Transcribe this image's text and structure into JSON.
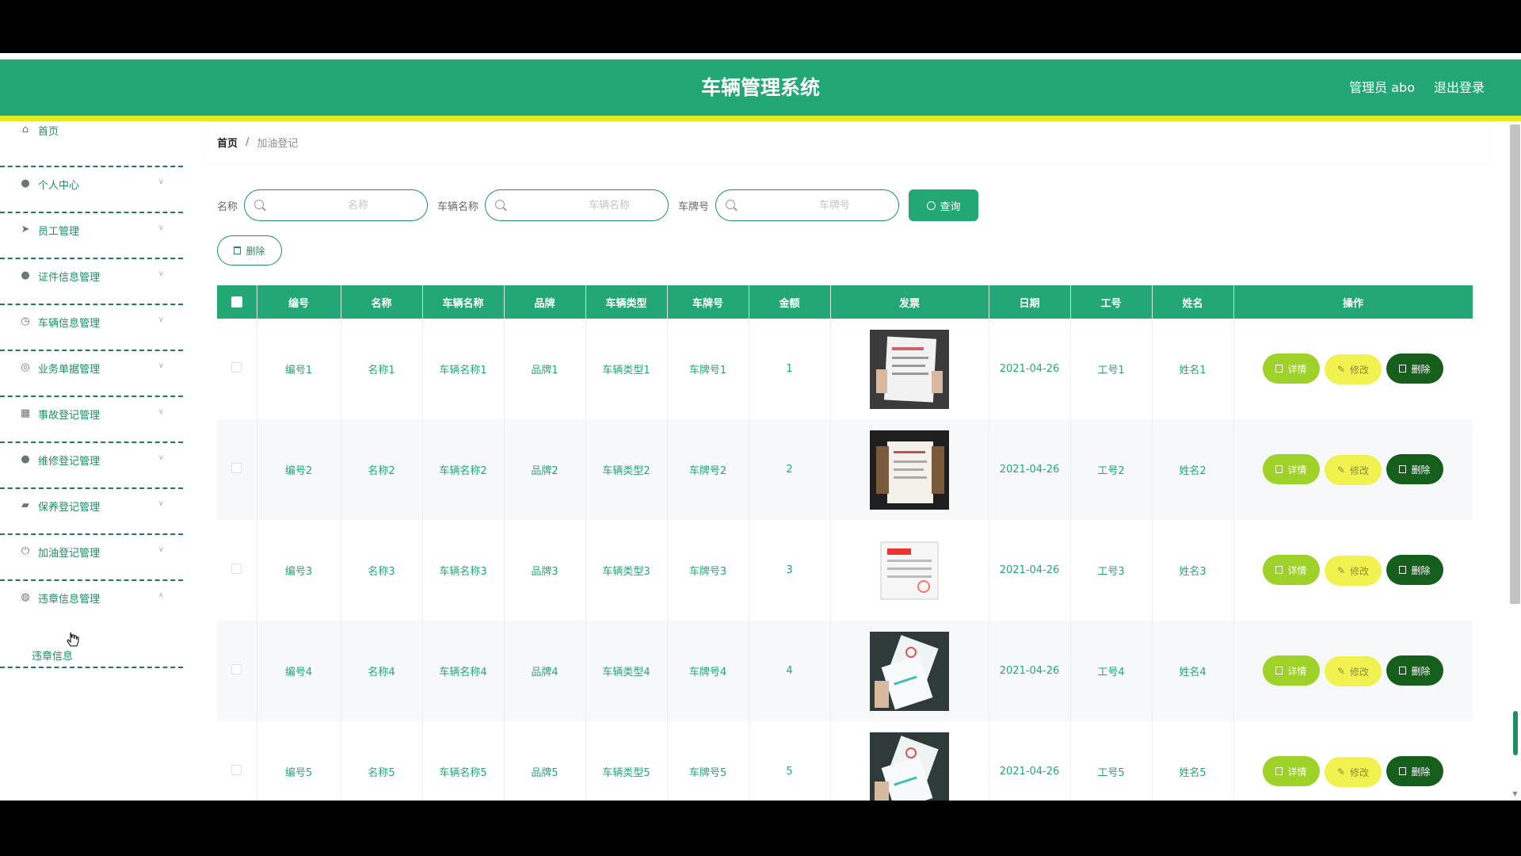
{
  "header": {
    "title": "车辆管理系统",
    "user": "管理员 abo",
    "logout": "退出登录"
  },
  "sidebar": {
    "items": [
      {
        "label": "首页",
        "icon": "home-icon"
      },
      {
        "label": "个人中心",
        "icon": "user-icon"
      },
      {
        "label": "员工管理",
        "icon": "send-icon"
      },
      {
        "label": "证件信息管理",
        "icon": "user-icon"
      },
      {
        "label": "车辆信息管理",
        "icon": "clock-icon"
      },
      {
        "label": "业务单据管理",
        "icon": "compass-icon"
      },
      {
        "label": "事故登记管理",
        "icon": "grid-icon"
      },
      {
        "label": "维修登记管理",
        "icon": "pin-icon"
      },
      {
        "label": "保养登记管理",
        "icon": "wallet-icon"
      },
      {
        "label": "加油登记管理",
        "icon": "power-icon"
      },
      {
        "label": "违章信息管理",
        "icon": "globe-icon"
      }
    ],
    "sub_item": "违章信息"
  },
  "breadcrumb": {
    "home": "首页",
    "sep": "/",
    "current": "加油登记"
  },
  "search": {
    "name_label": "名称",
    "name_placeholder": "名称",
    "vehicle_label": "车辆名称",
    "vehicle_placeholder": "车辆名称",
    "plate_label": "车牌号",
    "plate_placeholder": "车牌号",
    "query": "查询"
  },
  "actions": {
    "delete": "删除"
  },
  "table": {
    "headers": [
      "编号",
      "名称",
      "车辆名称",
      "品牌",
      "车辆类型",
      "车牌号",
      "金额",
      "发票",
      "日期",
      "工号",
      "姓名",
      "操作"
    ],
    "rows": [
      {
        "id": "编号1",
        "name": "名称1",
        "vehicle": "车辆名称1",
        "brand": "品牌1",
        "type": "车辆类型1",
        "plate": "车牌号1",
        "amount": "1",
        "date": "2021-04-26",
        "emp": "工号1",
        "person": "姓名1"
      },
      {
        "id": "编号2",
        "name": "名称2",
        "vehicle": "车辆名称2",
        "brand": "品牌2",
        "type": "车辆类型2",
        "plate": "车牌号2",
        "amount": "2",
        "date": "2021-04-26",
        "emp": "工号2",
        "person": "姓名2"
      },
      {
        "id": "编号3",
        "name": "名称3",
        "vehicle": "车辆名称3",
        "brand": "品牌3",
        "type": "车辆类型3",
        "plate": "车牌号3",
        "amount": "3",
        "date": "2021-04-26",
        "emp": "工号3",
        "person": "姓名3"
      },
      {
        "id": "编号4",
        "name": "名称4",
        "vehicle": "车辆名称4",
        "brand": "品牌4",
        "type": "车辆类型4",
        "plate": "车牌号4",
        "amount": "4",
        "date": "2021-04-26",
        "emp": "工号4",
        "person": "姓名4"
      },
      {
        "id": "编号5",
        "name": "名称5",
        "vehicle": "车辆名称5",
        "brand": "品牌5",
        "type": "车辆类型5",
        "plate": "车牌号5",
        "amount": "5",
        "date": "2021-04-26",
        "emp": "工号5",
        "person": "姓名5"
      }
    ],
    "btn_detail": "详情",
    "btn_edit": "修改",
    "btn_delete": "删除"
  },
  "colors": {
    "primary": "#23a775",
    "accent_bar": "#e6ec22",
    "detail": "#9ed229",
    "edit": "#f1f250",
    "delete": "#155e1c"
  }
}
